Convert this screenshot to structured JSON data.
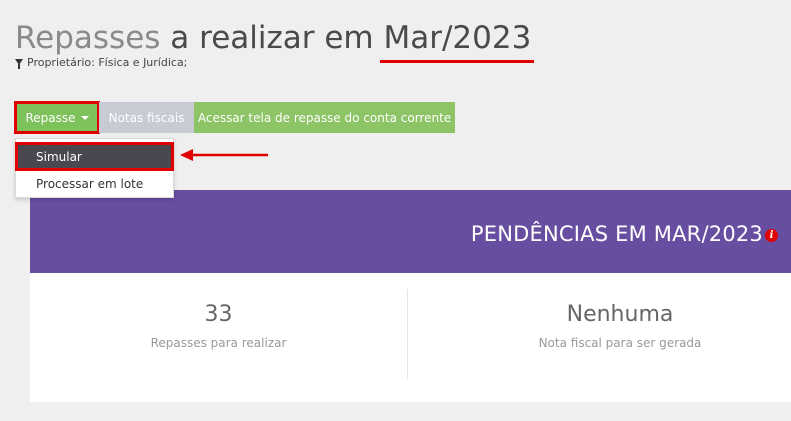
{
  "header": {
    "title_prefix_soft": "Repasses",
    "title_middle": " a realizar em ",
    "title_period": "Mar/2023",
    "filter_text": "Proprietário: Física e Jurídica;"
  },
  "toolbar": {
    "repasse_label": "Repasse",
    "notas_label": "Notas fiscais",
    "acessar_label": "Acessar tela de repasse do conta corrente"
  },
  "dropdown": {
    "items": [
      {
        "label": "Simular"
      },
      {
        "label": "Processar em lote"
      }
    ]
  },
  "pendencias": {
    "title": "PENDÊNCIAS EM MAR/2023",
    "info_icon": "i",
    "stats": [
      {
        "value": "33",
        "label": "Repasses para realizar"
      },
      {
        "value": "Nenhuma",
        "label": "Nota fiscal para ser gerada"
      }
    ]
  },
  "colors": {
    "annotation_red": "#e00000",
    "header_purple": "#674ea0",
    "button_green": "#7dc15a",
    "button_grey": "#c9cbd4",
    "selected_dark": "#4a4750"
  }
}
